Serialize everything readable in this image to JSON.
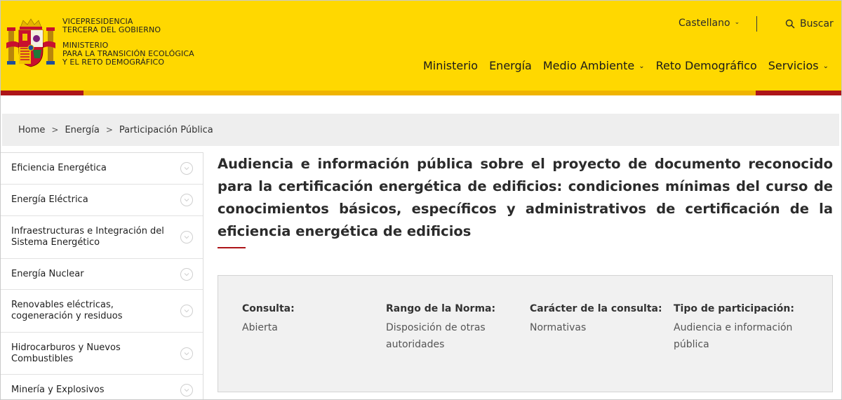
{
  "header": {
    "brand_lines_top": [
      "VICEPRESIDENCIA",
      "TERCERA DEL GOBIERNO"
    ],
    "brand_lines_bottom": [
      "MINISTERIO",
      "PARA LA TRANSICIÓN ECOLÓGICA",
      "Y EL RETO DEMOGRÁFICO"
    ],
    "language": "Castellano",
    "search_label": "Buscar",
    "nav": [
      {
        "label": "Ministerio",
        "has_dropdown": false
      },
      {
        "label": "Energía",
        "has_dropdown": false
      },
      {
        "label": "Medio Ambiente",
        "has_dropdown": true
      },
      {
        "label": "Reto Demográfico",
        "has_dropdown": false
      },
      {
        "label": "Servicios",
        "has_dropdown": true
      }
    ],
    "colors": {
      "yellow": "#ffd800",
      "red": "#ad1519",
      "amber": "#f0b400"
    }
  },
  "breadcrumb": [
    "Home",
    "Energía",
    "Participación Pública"
  ],
  "breadcrumb_separator": ">",
  "sidebar": {
    "items": [
      "Eficiencia Energética",
      "Energía Eléctrica",
      "Infraestructuras e Integración del Sistema Energético",
      "Energía Nuclear",
      "Renovables eléctricas, cogeneración y residuos",
      "Hidrocarburos y Nuevos Combustibles",
      "Minería y Explosivos"
    ]
  },
  "main": {
    "title": "Audiencia e información pública sobre el proyecto de documento reconocido para la certificación energética de edificios: condiciones mínimas del curso de conocimientos básicos, específicos y administrativos de certificación de la eficiencia energética de edificios",
    "info": [
      {
        "label": "Consulta:",
        "value": "Abierta"
      },
      {
        "label": "Rango de la Norma:",
        "value": "Disposición de otras autoridades"
      },
      {
        "label": "Carácter de la consulta:",
        "value": "Normativas"
      },
      {
        "label": "Tipo de participación:",
        "value": "Audiencia e información pública"
      }
    ]
  }
}
